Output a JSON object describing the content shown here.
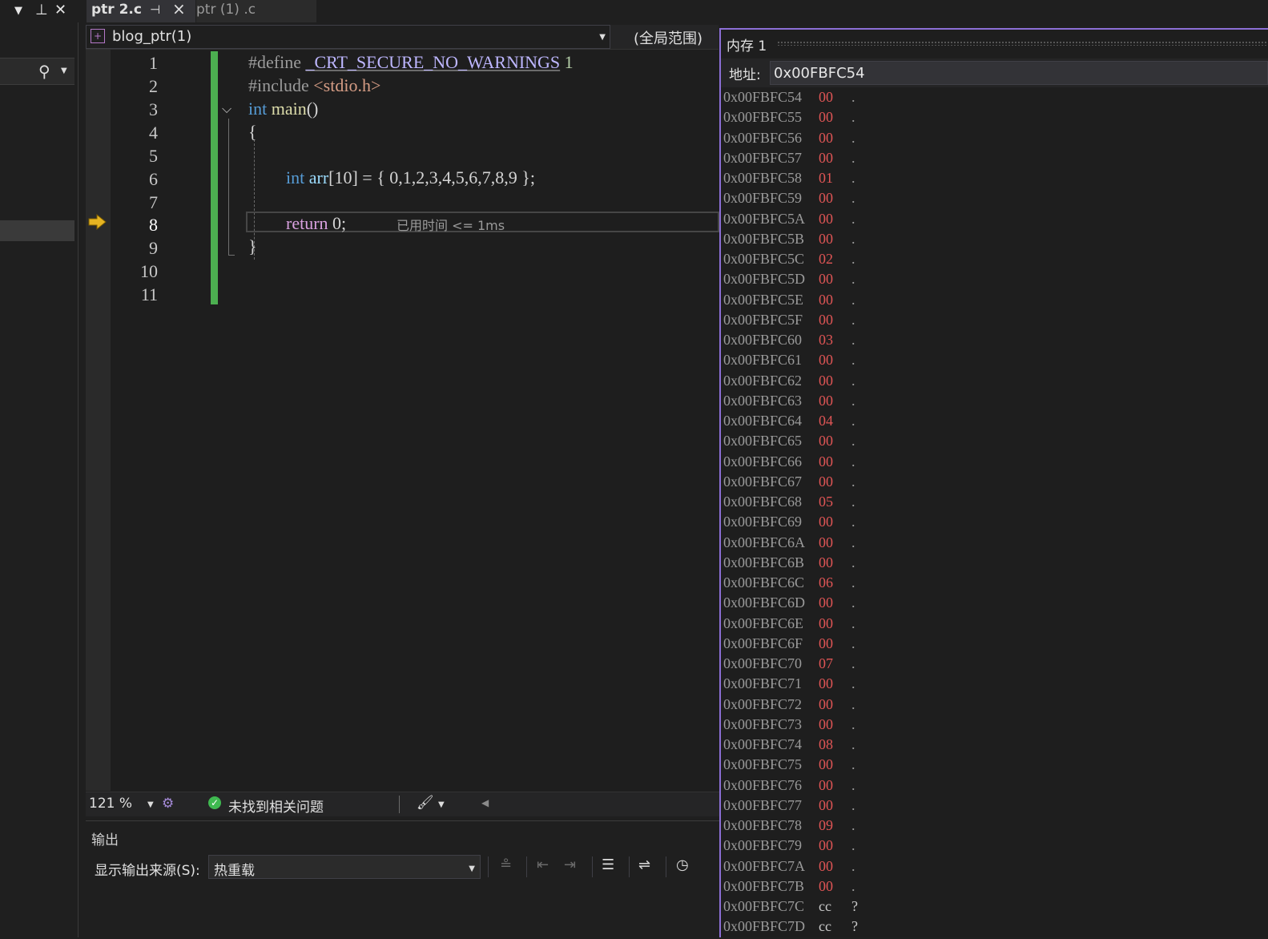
{
  "tabs": [
    {
      "label": "ptr 2.c",
      "active": true
    },
    {
      "label": "ptr (1) .c",
      "active": false
    }
  ],
  "navbar": {
    "file": "blog_ptr(1)",
    "scope": "(全局范围)"
  },
  "editor": {
    "line_numbers": [
      "1",
      "2",
      "3",
      "4",
      "5",
      "6",
      "7",
      "8",
      "9",
      "10",
      "11"
    ],
    "current_line": 8,
    "code": {
      "l1_pp": "#define ",
      "l1_macro": "_CRT_SECURE_NO_WARNINGS",
      "l1_val": " 1",
      "l2_pp": "#include ",
      "l2_hdr": "<stdio.h>",
      "l3_kw": "int",
      "l3_fn": " main",
      "l3_paren": "()",
      "l4": "{",
      "l6_kw": "int",
      "l6_var": " arr",
      "l6_rest": "[10] = { 0,1,2,3,4,5,6,7,8,9 };",
      "l8_kw": "return",
      "l8_rest": " 0;",
      "l9": "}"
    },
    "elapsed_hint": "已用时间 <= 1ms"
  },
  "status": {
    "zoom": "121 %",
    "issues": "未找到相关问题"
  },
  "output": {
    "title": "输出",
    "source_label": "显示输出来源(S):",
    "source_value": "热重载"
  },
  "memory": {
    "title": "内存 1",
    "address_label": "地址:",
    "address_value": "0x00FBFC54",
    "rows": [
      {
        "addr": "0x00FBFC54",
        "byte": "00",
        "ch": "."
      },
      {
        "addr": "0x00FBFC55",
        "byte": "00",
        "ch": "."
      },
      {
        "addr": "0x00FBFC56",
        "byte": "00",
        "ch": "."
      },
      {
        "addr": "0x00FBFC57",
        "byte": "00",
        "ch": "."
      },
      {
        "addr": "0x00FBFC58",
        "byte": "01",
        "ch": "."
      },
      {
        "addr": "0x00FBFC59",
        "byte": "00",
        "ch": "."
      },
      {
        "addr": "0x00FBFC5A",
        "byte": "00",
        "ch": "."
      },
      {
        "addr": "0x00FBFC5B",
        "byte": "00",
        "ch": "."
      },
      {
        "addr": "0x00FBFC5C",
        "byte": "02",
        "ch": "."
      },
      {
        "addr": "0x00FBFC5D",
        "byte": "00",
        "ch": "."
      },
      {
        "addr": "0x00FBFC5E",
        "byte": "00",
        "ch": "."
      },
      {
        "addr": "0x00FBFC5F",
        "byte": "00",
        "ch": "."
      },
      {
        "addr": "0x00FBFC60",
        "byte": "03",
        "ch": "."
      },
      {
        "addr": "0x00FBFC61",
        "byte": "00",
        "ch": "."
      },
      {
        "addr": "0x00FBFC62",
        "byte": "00",
        "ch": "."
      },
      {
        "addr": "0x00FBFC63",
        "byte": "00",
        "ch": "."
      },
      {
        "addr": "0x00FBFC64",
        "byte": "04",
        "ch": "."
      },
      {
        "addr": "0x00FBFC65",
        "byte": "00",
        "ch": "."
      },
      {
        "addr": "0x00FBFC66",
        "byte": "00",
        "ch": "."
      },
      {
        "addr": "0x00FBFC67",
        "byte": "00",
        "ch": "."
      },
      {
        "addr": "0x00FBFC68",
        "byte": "05",
        "ch": "."
      },
      {
        "addr": "0x00FBFC69",
        "byte": "00",
        "ch": "."
      },
      {
        "addr": "0x00FBFC6A",
        "byte": "00",
        "ch": "."
      },
      {
        "addr": "0x00FBFC6B",
        "byte": "00",
        "ch": "."
      },
      {
        "addr": "0x00FBFC6C",
        "byte": "06",
        "ch": "."
      },
      {
        "addr": "0x00FBFC6D",
        "byte": "00",
        "ch": "."
      },
      {
        "addr": "0x00FBFC6E",
        "byte": "00",
        "ch": "."
      },
      {
        "addr": "0x00FBFC6F",
        "byte": "00",
        "ch": "."
      },
      {
        "addr": "0x00FBFC70",
        "byte": "07",
        "ch": "."
      },
      {
        "addr": "0x00FBFC71",
        "byte": "00",
        "ch": "."
      },
      {
        "addr": "0x00FBFC72",
        "byte": "00",
        "ch": "."
      },
      {
        "addr": "0x00FBFC73",
        "byte": "00",
        "ch": "."
      },
      {
        "addr": "0x00FBFC74",
        "byte": "08",
        "ch": "."
      },
      {
        "addr": "0x00FBFC75",
        "byte": "00",
        "ch": "."
      },
      {
        "addr": "0x00FBFC76",
        "byte": "00",
        "ch": "."
      },
      {
        "addr": "0x00FBFC77",
        "byte": "00",
        "ch": "."
      },
      {
        "addr": "0x00FBFC78",
        "byte": "09",
        "ch": "."
      },
      {
        "addr": "0x00FBFC79",
        "byte": "00",
        "ch": "."
      },
      {
        "addr": "0x00FBFC7A",
        "byte": "00",
        "ch": "."
      },
      {
        "addr": "0x00FBFC7B",
        "byte": "00",
        "ch": "."
      },
      {
        "addr": "0x00FBFC7C",
        "byte": "cc",
        "ch": "?"
      },
      {
        "addr": "0x00FBFC7D",
        "byte": "cc",
        "ch": "?"
      }
    ]
  },
  "colors": {
    "accent": "#8c6fd6",
    "changed_byte": "#e05555",
    "change_bar": "#4caf50",
    "exec_arrow": "#e6b422"
  }
}
